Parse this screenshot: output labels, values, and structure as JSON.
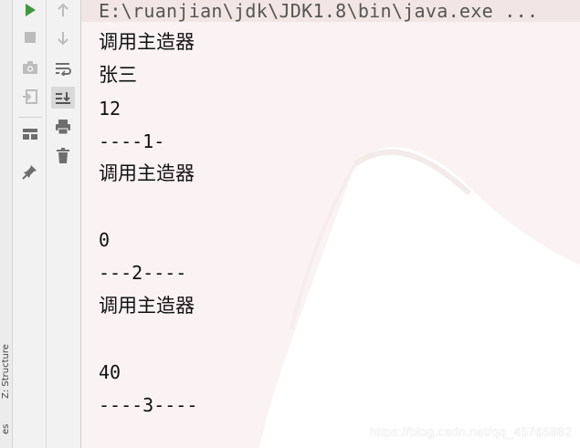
{
  "side_panel": {
    "structure_tab_label": "Z: Structure",
    "bottom_tab_label": "es"
  },
  "toolbar": {
    "run_icon": "play-icon",
    "stop_icon": "stop-icon",
    "snapshot_icon": "camera-icon",
    "restore_layout_icon": "exit-icon",
    "layout_icon": "layout-icon",
    "pin_icon": "pin-icon",
    "up_icon": "arrow-up-icon",
    "down_icon": "arrow-down-icon",
    "soft_wrap_icon": "soft-wrap-icon",
    "scroll_to_end_icon": "scroll-to-end-icon",
    "print_icon": "print-icon",
    "clear_icon": "trash-icon"
  },
  "console": {
    "command_line": "E:\\ruanjian\\jdk\\JDK1.8\\bin\\java.exe ...",
    "lines": [
      "调用主造器",
      "张三",
      "12",
      "----1-",
      "调用主造器",
      "",
      "0",
      "---2----",
      "调用主造器",
      "",
      "40",
      "----3----"
    ],
    "watermark": "https://blog.csdn.net/qq_45765882"
  },
  "colors": {
    "run_green": "#3c9a3c",
    "console_bg": "#fbf3f3",
    "icon_gray": "#6e6e6e"
  }
}
